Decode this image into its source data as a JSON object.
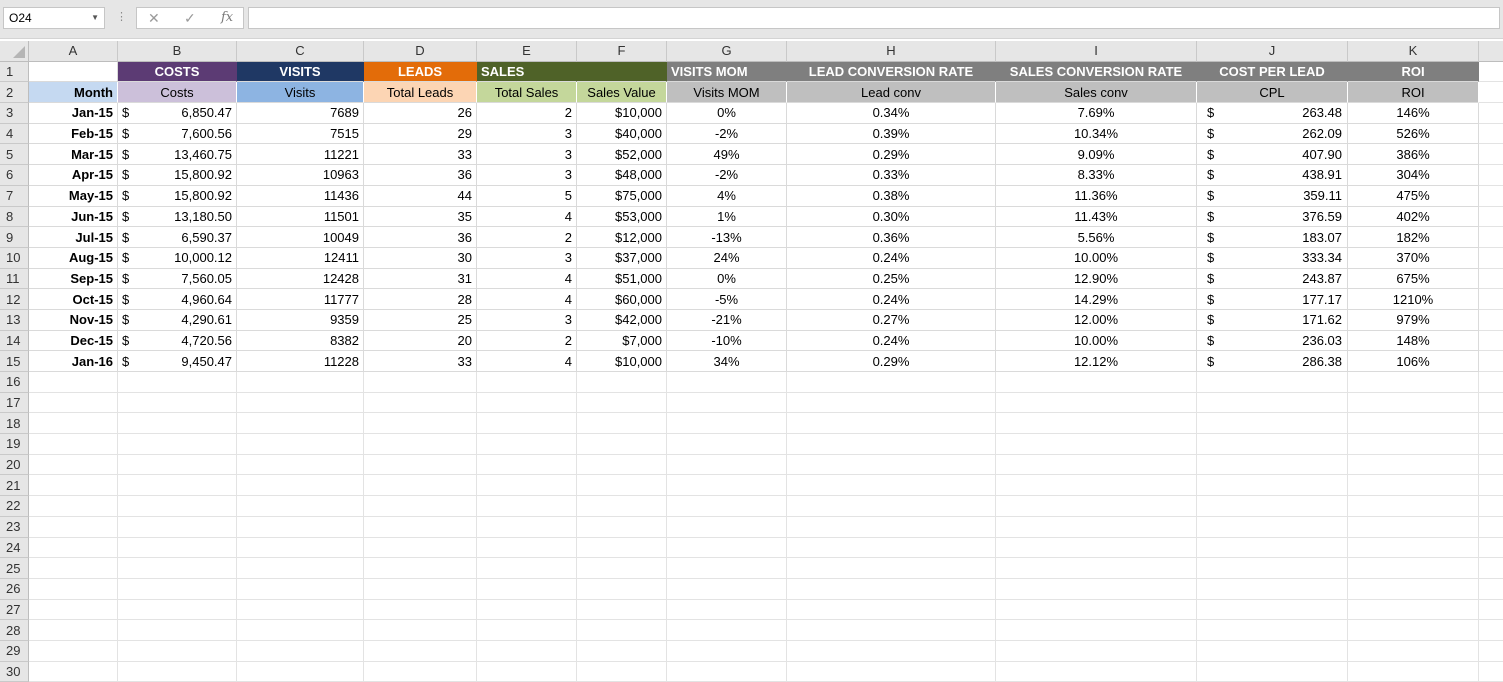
{
  "formula_bar": {
    "name_box": "O24",
    "cancel_icon": "✕",
    "enter_icon": "✓",
    "function_icon": "fx",
    "formula": ""
  },
  "columns": [
    "A",
    "B",
    "C",
    "D",
    "E",
    "F",
    "G",
    "H",
    "I",
    "J",
    "K"
  ],
  "header_row1": [
    {
      "text": "",
      "bg": "#ffffff",
      "align": "center"
    },
    {
      "text": "COSTS",
      "bg": "#5c3b74",
      "align": "center"
    },
    {
      "text": "VISITS",
      "bg": "#1f3864",
      "align": "center"
    },
    {
      "text": "LEADS",
      "bg": "#e36c09",
      "align": "center"
    },
    {
      "text": "SALES",
      "bg": "#4f6228",
      "align": "left"
    },
    {
      "text": "",
      "bg": "#4f6228",
      "align": "center"
    },
    {
      "text": "VISITS MOM",
      "bg": "#7f7f7f",
      "align": "left"
    },
    {
      "text": "LEAD CONVERSION RATE",
      "bg": "#7f7f7f",
      "align": "center"
    },
    {
      "text": "SALES CONVERSION RATE",
      "bg": "#7f7f7f",
      "align": "center"
    },
    {
      "text": "COST PER LEAD",
      "bg": "#7f7f7f",
      "align": "center"
    },
    {
      "text": "ROI",
      "bg": "#7f7f7f",
      "align": "center"
    }
  ],
  "header_row2": [
    {
      "text": "Month",
      "bg": "#c5d9f1",
      "align": "right",
      "bold": true
    },
    {
      "text": "Costs",
      "bg": "#ccc0da",
      "align": "center"
    },
    {
      "text": "Visits",
      "bg": "#8db4e2",
      "align": "center"
    },
    {
      "text": "Total Leads",
      "bg": "#fcd5b4",
      "align": "center"
    },
    {
      "text": "Total Sales",
      "bg": "#c4d79b",
      "align": "center"
    },
    {
      "text": "Sales Value",
      "bg": "#c4d79b",
      "align": "center"
    },
    {
      "text": "Visits MOM",
      "bg": "#bfbfbf",
      "align": "center"
    },
    {
      "text": "Lead conv",
      "bg": "#bfbfbf",
      "align": "center"
    },
    {
      "text": "Sales conv",
      "bg": "#bfbfbf",
      "align": "center"
    },
    {
      "text": "CPL",
      "bg": "#bfbfbf",
      "align": "center"
    },
    {
      "text": "ROI",
      "bg": "#bfbfbf",
      "align": "center"
    }
  ],
  "rows": [
    {
      "month": "Jan-15",
      "cost": "6,850.47",
      "visits": "7689",
      "leads": "26",
      "sales": "2",
      "value": "$10,000",
      "mom": "0%",
      "lconv": "0.34%",
      "sconv": "7.69%",
      "cpl": "263.48",
      "roi": "146%"
    },
    {
      "month": "Feb-15",
      "cost": "7,600.56",
      "visits": "7515",
      "leads": "29",
      "sales": "3",
      "value": "$40,000",
      "mom": "-2%",
      "lconv": "0.39%",
      "sconv": "10.34%",
      "cpl": "262.09",
      "roi": "526%"
    },
    {
      "month": "Mar-15",
      "cost": "13,460.75",
      "visits": "11221",
      "leads": "33",
      "sales": "3",
      "value": "$52,000",
      "mom": "49%",
      "lconv": "0.29%",
      "sconv": "9.09%",
      "cpl": "407.90",
      "roi": "386%"
    },
    {
      "month": "Apr-15",
      "cost": "15,800.92",
      "visits": "10963",
      "leads": "36",
      "sales": "3",
      "value": "$48,000",
      "mom": "-2%",
      "lconv": "0.33%",
      "sconv": "8.33%",
      "cpl": "438.91",
      "roi": "304%"
    },
    {
      "month": "May-15",
      "cost": "15,800.92",
      "visits": "11436",
      "leads": "44",
      "sales": "5",
      "value": "$75,000",
      "mom": "4%",
      "lconv": "0.38%",
      "sconv": "11.36%",
      "cpl": "359.11",
      "roi": "475%"
    },
    {
      "month": "Jun-15",
      "cost": "13,180.50",
      "visits": "11501",
      "leads": "35",
      "sales": "4",
      "value": "$53,000",
      "mom": "1%",
      "lconv": "0.30%",
      "sconv": "11.43%",
      "cpl": "376.59",
      "roi": "402%"
    },
    {
      "month": "Jul-15",
      "cost": "6,590.37",
      "visits": "10049",
      "leads": "36",
      "sales": "2",
      "value": "$12,000",
      "mom": "-13%",
      "lconv": "0.36%",
      "sconv": "5.56%",
      "cpl": "183.07",
      "roi": "182%"
    },
    {
      "month": "Aug-15",
      "cost": "10,000.12",
      "visits": "12411",
      "leads": "30",
      "sales": "3",
      "value": "$37,000",
      "mom": "24%",
      "lconv": "0.24%",
      "sconv": "10.00%",
      "cpl": "333.34",
      "roi": "370%"
    },
    {
      "month": "Sep-15",
      "cost": "7,560.05",
      "visits": "12428",
      "leads": "31",
      "sales": "4",
      "value": "$51,000",
      "mom": "0%",
      "lconv": "0.25%",
      "sconv": "12.90%",
      "cpl": "243.87",
      "roi": "675%"
    },
    {
      "month": "Oct-15",
      "cost": "4,960.64",
      "visits": "11777",
      "leads": "28",
      "sales": "4",
      "value": "$60,000",
      "mom": "-5%",
      "lconv": "0.24%",
      "sconv": "14.29%",
      "cpl": "177.17",
      "roi": "1210%"
    },
    {
      "month": "Nov-15",
      "cost": "4,290.61",
      "visits": "9359",
      "leads": "25",
      "sales": "3",
      "value": "$42,000",
      "mom": "-21%",
      "lconv": "0.27%",
      "sconv": "12.00%",
      "cpl": "171.62",
      "roi": "979%"
    },
    {
      "month": "Dec-15",
      "cost": "4,720.56",
      "visits": "8382",
      "leads": "20",
      "sales": "2",
      "value": "$7,000",
      "mom": "-10%",
      "lconv": "0.24%",
      "sconv": "10.00%",
      "cpl": "236.03",
      "roi": "148%"
    },
    {
      "month": "Jan-16",
      "cost": "9,450.47",
      "visits": "11228",
      "leads": "33",
      "sales": "4",
      "value": "$10,000",
      "mom": "34%",
      "lconv": "0.29%",
      "sconv": "12.12%",
      "cpl": "286.38",
      "roi": "106%"
    }
  ],
  "currency_symbol": "$",
  "empty_row_numbers": [
    "16",
    "17",
    "18",
    "19",
    "20",
    "21",
    "22",
    "23",
    "24",
    "25",
    "26",
    "27",
    "28",
    "29",
    "30"
  ]
}
